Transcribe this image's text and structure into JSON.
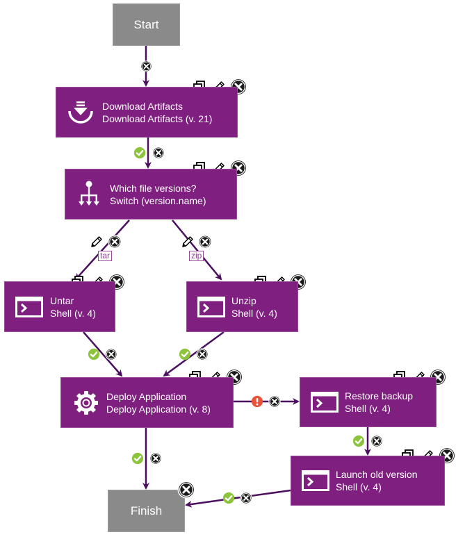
{
  "colors": {
    "step_bg": "#7f1f7f",
    "terminal_bg": "#8a8a8a",
    "edge": "#4b0f5f",
    "success": "#8cc43c",
    "failure": "#e8533a",
    "control": "#1a1a1a"
  },
  "nodes": {
    "start": {
      "label": "Start"
    },
    "download": {
      "title": "Download Artifacts",
      "subtitle": "Download Artifacts (v. 21)",
      "icon": "download-icon"
    },
    "switch": {
      "title": "Which file versions?",
      "subtitle": "Switch (version.name)",
      "icon": "switch-icon"
    },
    "untar": {
      "title": "Untar",
      "subtitle": "Shell (v. 4)",
      "icon": "shell-icon"
    },
    "unzip": {
      "title": "Unzip",
      "subtitle": "Shell (v. 4)",
      "icon": "shell-icon"
    },
    "deploy": {
      "title": "Deploy Application",
      "subtitle": "Deploy Application (v. 8)",
      "icon": "gear-icon"
    },
    "restore": {
      "title": "Restore backup",
      "subtitle": "Shell (v. 4)",
      "icon": "shell-icon"
    },
    "launch": {
      "title": "Launch old version",
      "subtitle": "Shell (v. 4)",
      "icon": "shell-icon"
    },
    "finish": {
      "label": "Finish"
    }
  },
  "edges": [
    {
      "from": "start",
      "to": "download",
      "condition": "none"
    },
    {
      "from": "download",
      "to": "switch",
      "condition": "success"
    },
    {
      "from": "switch",
      "to": "untar",
      "condition": "value",
      "value": "tar"
    },
    {
      "from": "switch",
      "to": "unzip",
      "condition": "value",
      "value": "zip"
    },
    {
      "from": "untar",
      "to": "deploy",
      "condition": "success"
    },
    {
      "from": "unzip",
      "to": "deploy",
      "condition": "success"
    },
    {
      "from": "deploy",
      "to": "restore",
      "condition": "failure"
    },
    {
      "from": "deploy",
      "to": "finish",
      "condition": "success"
    },
    {
      "from": "restore",
      "to": "launch",
      "condition": "success"
    },
    {
      "from": "launch",
      "to": "finish",
      "condition": "success"
    }
  ],
  "edge_labels": {
    "tar": "tar",
    "zip": "zip"
  }
}
